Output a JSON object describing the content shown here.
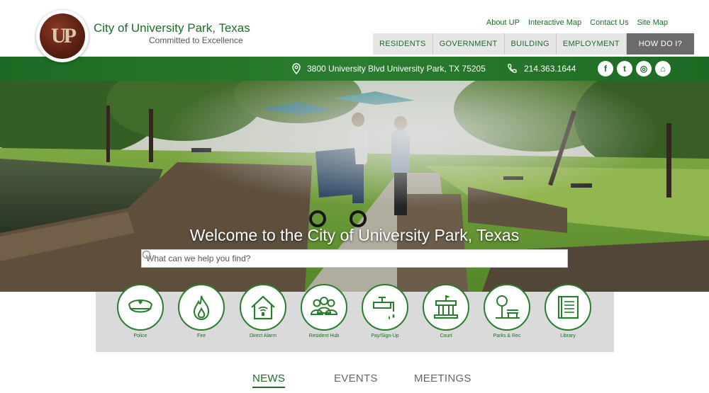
{
  "header": {
    "logo_text": "UP",
    "title": "City of University Park, Texas",
    "tagline": "Committed to Excellence"
  },
  "utility_nav": [
    "About UP",
    "Interactive Map",
    "Contact Us",
    "Site Map"
  ],
  "main_nav": [
    "RESIDENTS",
    "GOVERNMENT",
    "BUILDING",
    "EMPLOYMENT"
  ],
  "how_do_i": "HOW DO I?",
  "contact": {
    "address": "3800 University Blvd University Park, TX 75205",
    "phone": "214.363.1644"
  },
  "socials": [
    {
      "name": "facebook-icon",
      "glyph": "f"
    },
    {
      "name": "twitter-icon",
      "glyph": "t"
    },
    {
      "name": "instagram-icon",
      "glyph": "◎"
    },
    {
      "name": "nextdoor-icon",
      "glyph": "⌂"
    }
  ],
  "hero": {
    "welcome": "Welcome to the City of University Park, Texas",
    "search_placeholder": "What can we help you find?"
  },
  "quick_links": [
    {
      "label": "Police",
      "icon": "police-cap-icon"
    },
    {
      "label": "Fire",
      "icon": "flame-icon"
    },
    {
      "label": "Direct Alarm",
      "icon": "house-alarm-icon"
    },
    {
      "label": "Resident Hub",
      "icon": "people-icon"
    },
    {
      "label": "Pay/Sign-Up",
      "icon": "water-faucet-icon"
    },
    {
      "label": "Court",
      "icon": "courthouse-icon"
    },
    {
      "label": "Parks & Rec",
      "icon": "park-bench-icon"
    },
    {
      "label": "Library",
      "icon": "book-icon"
    }
  ],
  "tabs": [
    "NEWS",
    "EVENTS",
    "MEETINGS"
  ],
  "colors": {
    "brand_green": "#1f6b2a",
    "bar_green": "#2a7d2e",
    "nav_gray": "#e6e6e6",
    "how_do_gray": "#6b6b6b"
  }
}
